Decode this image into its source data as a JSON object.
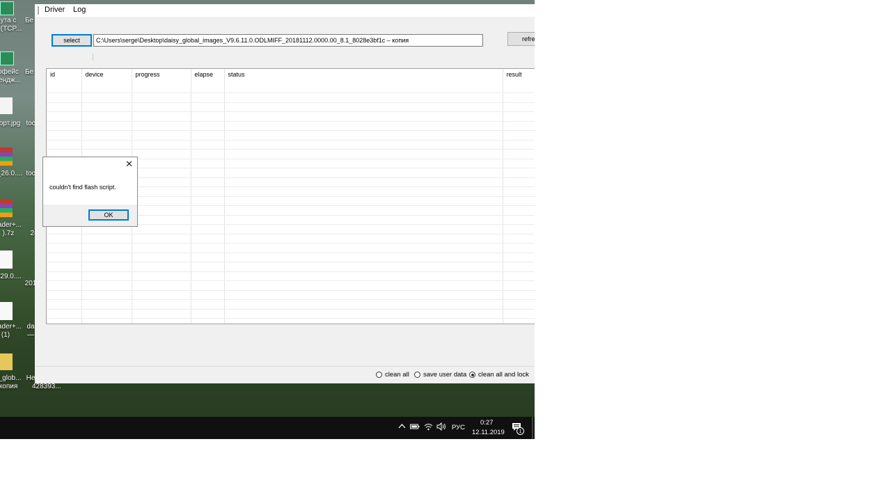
{
  "desktop": {
    "icons": [
      {
        "name": "icon-1",
        "label_a": "ута с",
        "label_b": "(TCP...",
        "side": "Бе"
      },
      {
        "name": "icon-2",
        "label_a": "рфейс",
        "label_b": "ендж...",
        "side": "Бе"
      },
      {
        "name": "icon-3",
        "label_a": "орт.jpg",
        "label_b": "",
        "side": "toc"
      },
      {
        "name": "icon-4",
        "label_a": "_26.0....",
        "label_b": "",
        "side": "toc"
      },
      {
        "name": "icon-5",
        "label_a": "ader+...",
        "label_b": ").7z",
        "side": "2("
      },
      {
        "name": "icon-6",
        "label_a": "r29.0....",
        "label_b": "",
        "side": "201"
      },
      {
        "name": "icon-7",
        "label_a": "ader+...",
        "label_b": "(1)",
        "side": "da"
      },
      {
        "name": "icon-8",
        "label_a": "_glob...",
        "label_b": "копия",
        "side": "He"
      }
    ],
    "extra_labels": [
      "428393...",
      "—"
    ]
  },
  "app": {
    "menu": [
      "Driver",
      "Log"
    ],
    "select_label": "select",
    "path_value": "C:\\Users\\serge\\Desktop\\daisy_global_images_V9.6.11.0.ODLMIFF_20181112.0000.00_8.1_8028e3bf1c – копия",
    "refresh_label": "refresh",
    "columns": [
      "id",
      "device",
      "progress",
      "elapse",
      "status",
      "result"
    ],
    "radio_options": [
      {
        "label": "clean all",
        "checked": false
      },
      {
        "label": "save user data",
        "checked": false
      },
      {
        "label": "clean all and lock",
        "checked": true
      }
    ]
  },
  "dialog": {
    "message": "couldn't find flash script.",
    "ok_label": "OK"
  },
  "taskbar": {
    "language": "РУС",
    "time": "0:27",
    "date": "12.11.2019",
    "notification_count": "1"
  }
}
